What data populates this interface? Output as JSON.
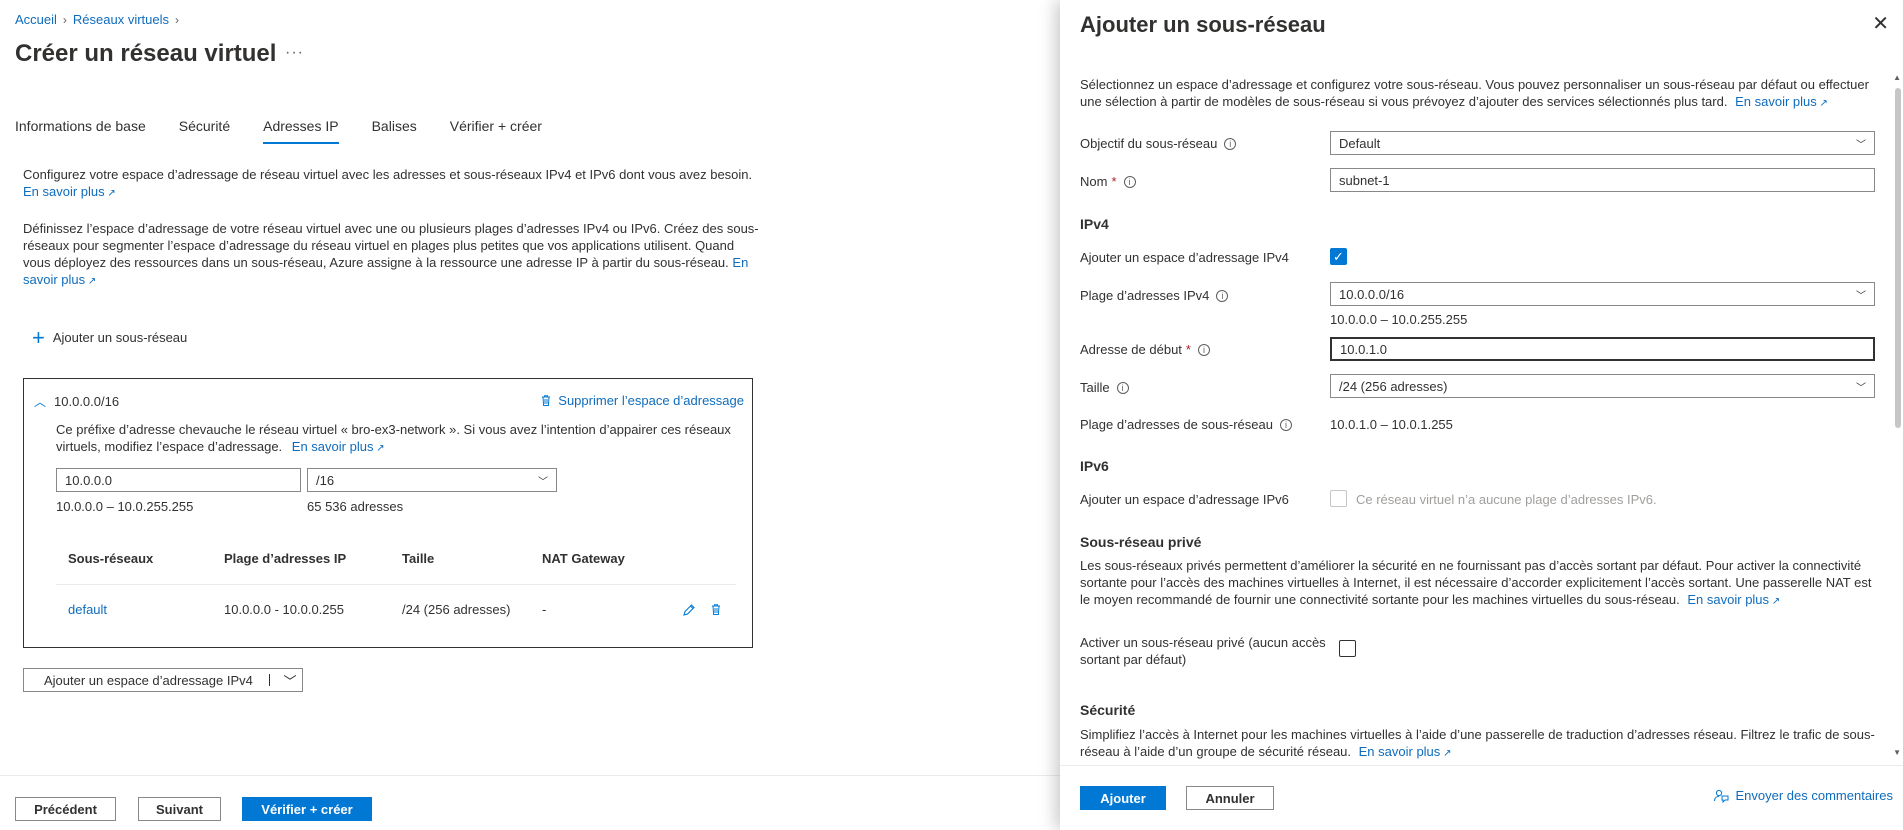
{
  "breadcrumb": {
    "home": "Accueil",
    "vnets": "Réseaux virtuels"
  },
  "page": {
    "title": "Créer un réseau virtuel",
    "more": "···"
  },
  "tabs": [
    {
      "label": "Informations de base"
    },
    {
      "label": "Sécurité"
    },
    {
      "label": "Adresses IP"
    },
    {
      "label": "Balises"
    },
    {
      "label": "Vérifier + créer"
    }
  ],
  "intro1": {
    "text": "Configurez votre espace d’adressage de réseau virtuel avec les adresses et sous-réseaux IPv4 et IPv6 dont vous avez besoin.",
    "link": "En savoir plus"
  },
  "intro2": {
    "text": "Définissez l’espace d’adressage de votre réseau virtuel avec une ou plusieurs plages d’adresses IPv4 ou IPv6. Créez des sous-réseaux pour segmenter l’espace d’adressage du réseau virtuel en plages plus petites que vos applications utilisent. Quand vous déployez des ressources dans un sous-réseau, Azure assigne à la ressource une adresse IP à partir du sous-réseau.",
    "link": "En savoir plus"
  },
  "add_subnet": "Ajouter un sous-réseau",
  "address_space": {
    "cidr": "10.0.0.0/16",
    "delete": "Supprimer l’espace d’adressage",
    "overlap_text": "Ce préfixe d’adresse chevauche le réseau virtuel « bro-ex3-network ». Si vous avez l’intention d’appairer ces réseaux virtuels, modifiez l’espace d’adressage.",
    "overlap_link": "En savoir plus",
    "ip": "10.0.0.0",
    "prefix": "/16",
    "range": "10.0.0.0 – 10.0.255.255",
    "count": "65 536 adresses",
    "table": {
      "headers": [
        "Sous-réseaux",
        "Plage d’adresses IP",
        "Taille",
        "NAT Gateway"
      ],
      "rows": [
        {
          "name": "default",
          "range": "10.0.0.0 - 10.0.0.255",
          "size": "/24 (256 adresses)",
          "nat": "-"
        }
      ]
    }
  },
  "add_space_button": "Ajouter un espace d’adressage IPv4",
  "footer": {
    "prev": "Précédent",
    "next": "Suivant",
    "review": "Vérifier + créer"
  },
  "panel": {
    "title": "Ajouter un sous-réseau",
    "intro": "Sélectionnez un espace d’adressage et configurez votre sous-réseau. Vous pouvez personnaliser un sous-réseau par défaut ou effectuer une sélection à partir de modèles de sous-réseau si vous prévoyez d’ajouter des services sélectionnés plus tard.",
    "intro_link": "En savoir plus",
    "purpose_label": "Objectif du sous-réseau",
    "purpose_value": "Default",
    "name_label": "Nom",
    "name_value": "subnet-1",
    "ipv4_header": "IPv4",
    "add_ipv4_label": "Ajouter un espace d’adressage IPv4",
    "ipv4_range_label": "Plage d’adresses IPv4",
    "ipv4_range_value": "10.0.0.0/16",
    "ipv4_range_hint": "10.0.0.0 – 10.0.255.255",
    "start_label": "Adresse de début",
    "start_value": "10.0.1.0",
    "size_label": "Taille",
    "size_value": "/24 (256 adresses)",
    "subnet_range_label": "Plage d’adresses de sous-réseau",
    "subnet_range_value": "10.0.1.0 – 10.0.1.255",
    "ipv6_header": "IPv6",
    "add_ipv6_label": "Ajouter un espace d’adressage IPv6",
    "ipv6_disabled_text": "Ce réseau virtuel n’a aucune plage d’adresses IPv6.",
    "private_header": "Sous-réseau privé",
    "private_text": "Les sous-réseaux privés permettent d’améliorer la sécurité en ne fournissant pas d’accès sortant par défaut. Pour activer la connectivité sortante pour l’accès des machines virtuelles à Internet, il est nécessaire d’accorder explicitement l’accès sortant. Une passerelle NAT est le moyen recommandé de fournir une connectivité sortante pour les machines virtuelles du sous-réseau.",
    "private_link": "En savoir plus",
    "private_toggle_label": "Activer un sous-réseau privé (aucun accès sortant par défaut)",
    "security_header": "Sécurité",
    "security_text": "Simplifiez l’accès à Internet pour les machines virtuelles à l’aide d’une passerelle de traduction d’adresses réseau. Filtrez le trafic de sous-réseau à l’aide d’un groupe de sécurité réseau.",
    "security_link": "En savoir plus",
    "add_button": "Ajouter",
    "cancel_button": "Annuler",
    "feedback": "Envoyer des commentaires"
  }
}
